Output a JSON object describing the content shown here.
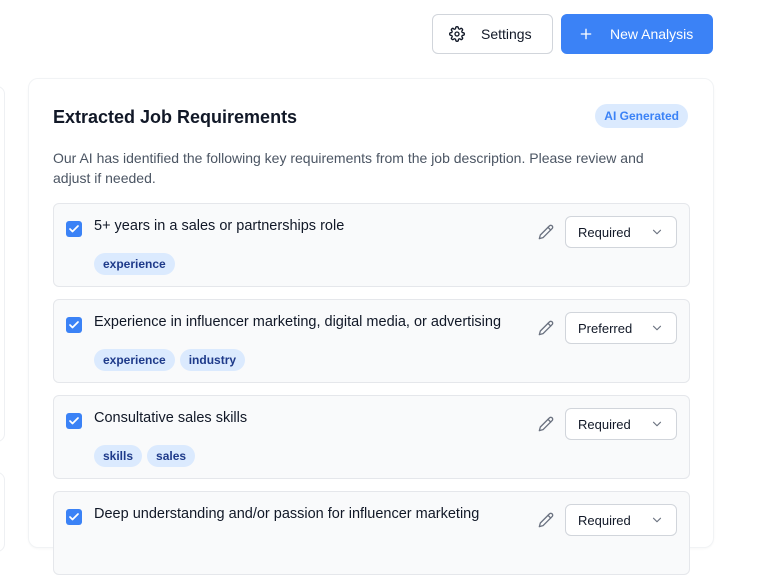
{
  "toolbar": {
    "settings_label": "Settings",
    "new_analysis_label": "New Analysis"
  },
  "card": {
    "title": "Extracted Job Requirements",
    "badge": "AI Generated",
    "description": "Our AI has identified the following key requirements from the job description. Please review and adjust if needed."
  },
  "requirements": [
    {
      "text": "5+ years in a sales or partnerships role",
      "checked": true,
      "priority": "Required",
      "tags": [
        "experience"
      ]
    },
    {
      "text": "Experience in influencer marketing, digital media, or advertising",
      "checked": true,
      "priority": "Preferred",
      "tags": [
        "experience",
        "industry"
      ]
    },
    {
      "text": "Consultative sales skills",
      "checked": true,
      "priority": "Required",
      "tags": [
        "skills",
        "sales"
      ]
    },
    {
      "text": "Deep understanding and/or passion for influencer marketing",
      "checked": true,
      "priority": "Required",
      "tags": []
    }
  ],
  "colors": {
    "accent": "#3b82f6",
    "tag_bg": "#dbeafe",
    "tag_text": "#1e3a8a"
  },
  "icons": {
    "settings": "gear-icon",
    "new_analysis": "plus-icon",
    "edit": "pencil-icon",
    "dropdown": "chevron-down-icon",
    "check": "check-icon"
  }
}
